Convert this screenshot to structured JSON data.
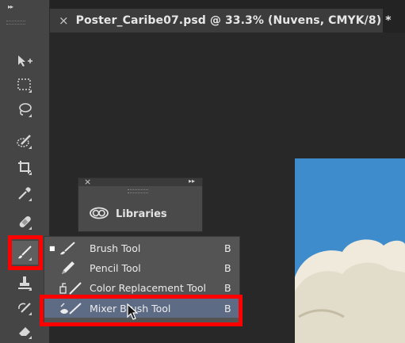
{
  "tab": {
    "close_glyph": "×",
    "title": "Poster_Caribe07.psd @ 33.3% (Nuvens, CMYK/8) *"
  },
  "toolbar": {
    "collapse_glyph": "▸▸",
    "tools": [
      {
        "name": "move-tool",
        "icon": "move-arrow-icon"
      },
      {
        "name": "marquee-tool",
        "icon": "dotted-rectangle-icon"
      },
      {
        "name": "lasso-tool",
        "icon": "lasso-icon"
      },
      {
        "name": "quick-selection-tool",
        "icon": "quick-selection-brush-icon"
      },
      {
        "name": "crop-tool",
        "icon": "crop-icon"
      },
      {
        "name": "eyedropper-tool",
        "icon": "eyedropper-icon"
      },
      {
        "name": "healing-brush-tool",
        "icon": "bandage-icon"
      },
      {
        "name": "brush-tool",
        "icon": "brush-icon",
        "active": true
      },
      {
        "name": "clone-stamp-tool",
        "icon": "stamp-icon"
      },
      {
        "name": "history-brush-tool",
        "icon": "history-brush-icon"
      },
      {
        "name": "eraser-tool",
        "icon": "eraser-icon"
      }
    ]
  },
  "libraries_panel": {
    "close_glyph": "×",
    "collapse_glyph": "▸▸",
    "label": "Libraries",
    "icon": "creative-cloud-libraries-icon"
  },
  "flyout": {
    "items": [
      {
        "label": "Brush Tool",
        "shortcut": "B",
        "selected": true,
        "icon": "brush-icon"
      },
      {
        "label": "Pencil Tool",
        "shortcut": "B",
        "selected": false,
        "icon": "pencil-icon"
      },
      {
        "label": "Color Replacement Tool",
        "shortcut": "B",
        "selected": false,
        "icon": "color-replacement-icon"
      },
      {
        "label": "Mixer Brush Tool",
        "shortcut": "B",
        "selected": false,
        "hovered": true,
        "icon": "mixer-brush-icon"
      }
    ],
    "selected_marker": "■"
  },
  "colors": {
    "highlight": "#ff0000",
    "canvas_art": "#3f8ccc",
    "hover_row": "#5d6b85"
  }
}
